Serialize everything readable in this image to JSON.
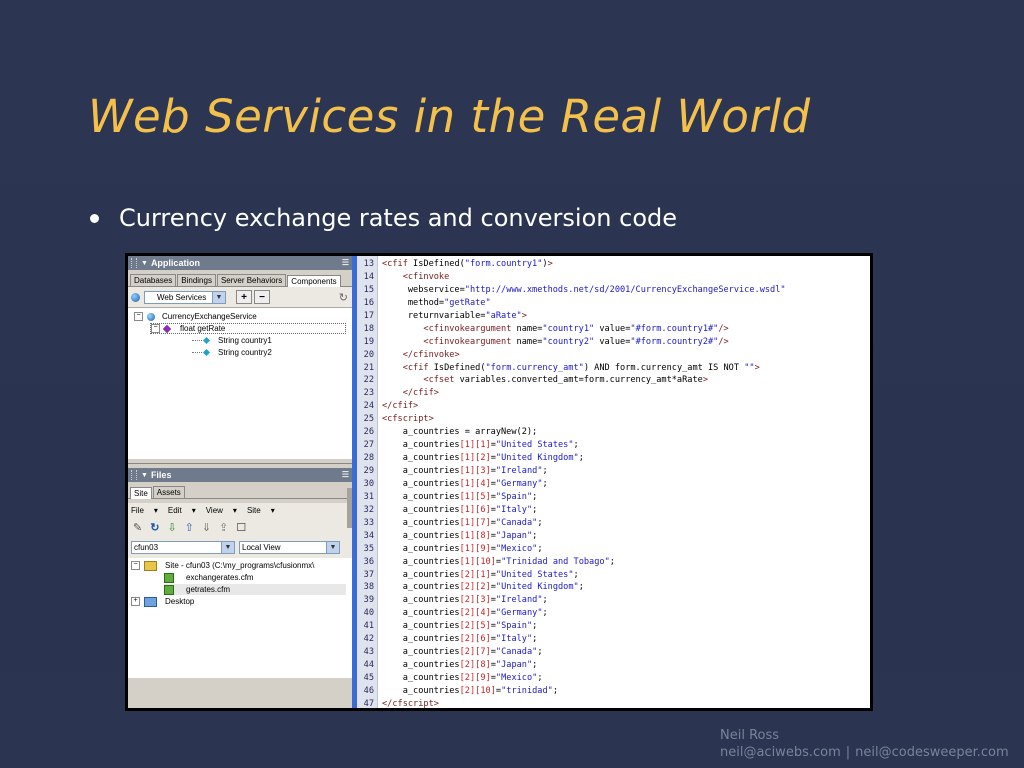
{
  "slide": {
    "title": "Web Services in the Real World",
    "bullet": "Currency exchange rates and conversion code",
    "footer": {
      "name": "Neil Ross",
      "email1": "neil@aciwebs.com",
      "separator": "|",
      "email2": "neil@codesweeper.com"
    }
  },
  "application_panel": {
    "title": "Application",
    "tabs": [
      "Databases",
      "Bindings",
      "Server Behaviors",
      "Components"
    ],
    "active_tab": "Components",
    "component_type": "Web Services",
    "add_label": "+",
    "remove_label": "−",
    "tree": [
      {
        "label": "CurrencyExchangeService",
        "level": 0,
        "expander": "−"
      },
      {
        "label": "float getRate",
        "level": 1,
        "expander": "−"
      },
      {
        "label": "String country1",
        "level": 2
      },
      {
        "label": "String country2",
        "level": 2
      }
    ]
  },
  "files_panel": {
    "title": "Files",
    "tabs": [
      "Site",
      "Assets"
    ],
    "active_tab": "Site",
    "menus": [
      "File",
      "Edit",
      "View",
      "Site"
    ],
    "site_select": "cfun03",
    "view_select": "Local View",
    "tree": [
      {
        "label": "Site - cfun03 (C:\\my_programs\\cfusionmx\\",
        "expander": "−"
      },
      {
        "label": "exchangerates.cfm"
      },
      {
        "label": "getrates.cfm"
      },
      {
        "label": "Desktop",
        "expander": "+"
      }
    ]
  },
  "code_editor": {
    "line_numbers": [
      "13",
      "14",
      "15",
      "16",
      "17",
      "18",
      "19",
      "20",
      "21",
      "22",
      "23",
      "24",
      "25",
      "26",
      "27",
      "28",
      "29",
      "30",
      "31",
      "32",
      "33",
      "34",
      "35",
      "36",
      "37",
      "38",
      "39",
      "40",
      "41",
      "42",
      "43",
      "44",
      "45",
      "46",
      "47"
    ],
    "lines": [
      "<cfif IsDefined(\"form.country1\")>",
      "    <cfinvoke",
      "     webservice=\"http://www.xmethods.net/sd/2001/CurrencyExchangeService.wsdl\"",
      "     method=\"getRate\"",
      "     returnvariable=\"aRate\">",
      "        <cfinvokeargument name=\"country1\" value=\"#form.country1#\"/>",
      "        <cfinvokeargument name=\"country2\" value=\"#form.country2#\"/>",
      "    </cfinvoke>",
      "    <cfif IsDefined(\"form.currency_amt\") AND form.currency_amt IS NOT \"\">",
      "        <cfset variables.converted_amt=form.currency_amt*aRate>",
      "    </cfif>",
      "</cfif>",
      "<cfscript>",
      "    a_countries = arrayNew(2);",
      "    a_countries[1][1]=\"United States\";",
      "    a_countries[1][2]=\"United Kingdom\";",
      "    a_countries[1][3]=\"Ireland\";",
      "    a_countries[1][4]=\"Germany\";",
      "    a_countries[1][5]=\"Spain\";",
      "    a_countries[1][6]=\"Italy\";",
      "    a_countries[1][7]=\"Canada\";",
      "    a_countries[1][8]=\"Japan\";",
      "    a_countries[1][9]=\"Mexico\";",
      "    a_countries[1][10]=\"Trinidad and Tobago\";",
      "    a_countries[2][1]=\"United States\";",
      "    a_countries[2][2]=\"United Kingdom\";",
      "    a_countries[2][3]=\"Ireland\";",
      "    a_countries[2][4]=\"Germany\";",
      "    a_countries[2][5]=\"Spain\";",
      "    a_countries[2][6]=\"Italy\";",
      "    a_countries[2][7]=\"Canada\";",
      "    a_countries[2][8]=\"Japan\";",
      "    a_countries[2][9]=\"Mexico\";",
      "    a_countries[2][10]=\"trinidad\";",
      "</cfscript>"
    ]
  },
  "colors": {
    "slide_bg": "#2b3550",
    "title": "#f3c04c",
    "gutter_accent": "#3a6bd6"
  }
}
